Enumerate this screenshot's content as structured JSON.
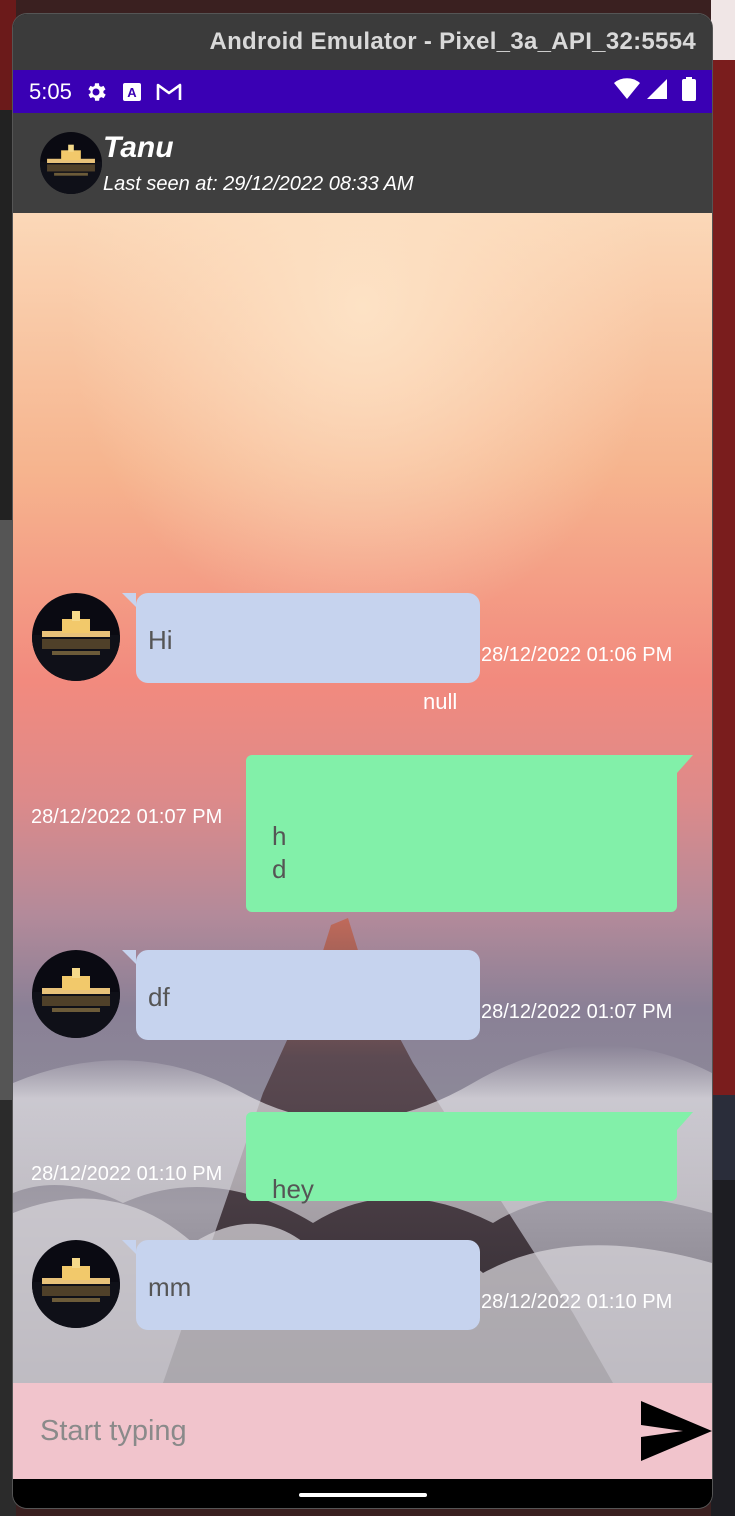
{
  "window": {
    "title": "Android Emulator - Pixel_3a_API_32:5554"
  },
  "status_bar": {
    "time": "5:05",
    "icons": [
      "gear-icon",
      "a-badge-icon",
      "gmail-icon"
    ],
    "right_icons": [
      "wifi-icon",
      "signal-icon",
      "battery-icon"
    ]
  },
  "header": {
    "name": "Tanu",
    "last_seen": "Last seen at: 29/12/2022 08:33 AM"
  },
  "messages": [
    {
      "direction": "incoming",
      "text": "Hi",
      "timestamp": "28/12/2022 01:06 PM",
      "extra": "null"
    },
    {
      "direction": "outgoing",
      "text": "h\nd",
      "timestamp": "28/12/2022 01:07 PM"
    },
    {
      "direction": "incoming",
      "text": "df",
      "timestamp": "28/12/2022 01:07 PM"
    },
    {
      "direction": "outgoing",
      "text": "hey",
      "timestamp": "28/12/2022 01:10 PM"
    },
    {
      "direction": "incoming",
      "text": "mm",
      "timestamp": "28/12/2022 01:10 PM"
    }
  ],
  "input": {
    "placeholder": "Start typing"
  },
  "colors": {
    "incoming_bubble": "#c6d3ee",
    "outgoing_bubble": "#82f0a9",
    "status_bar": "#3a00b4",
    "input_bar": "#f1c4cc",
    "app_bar": "#3f3f3f"
  }
}
